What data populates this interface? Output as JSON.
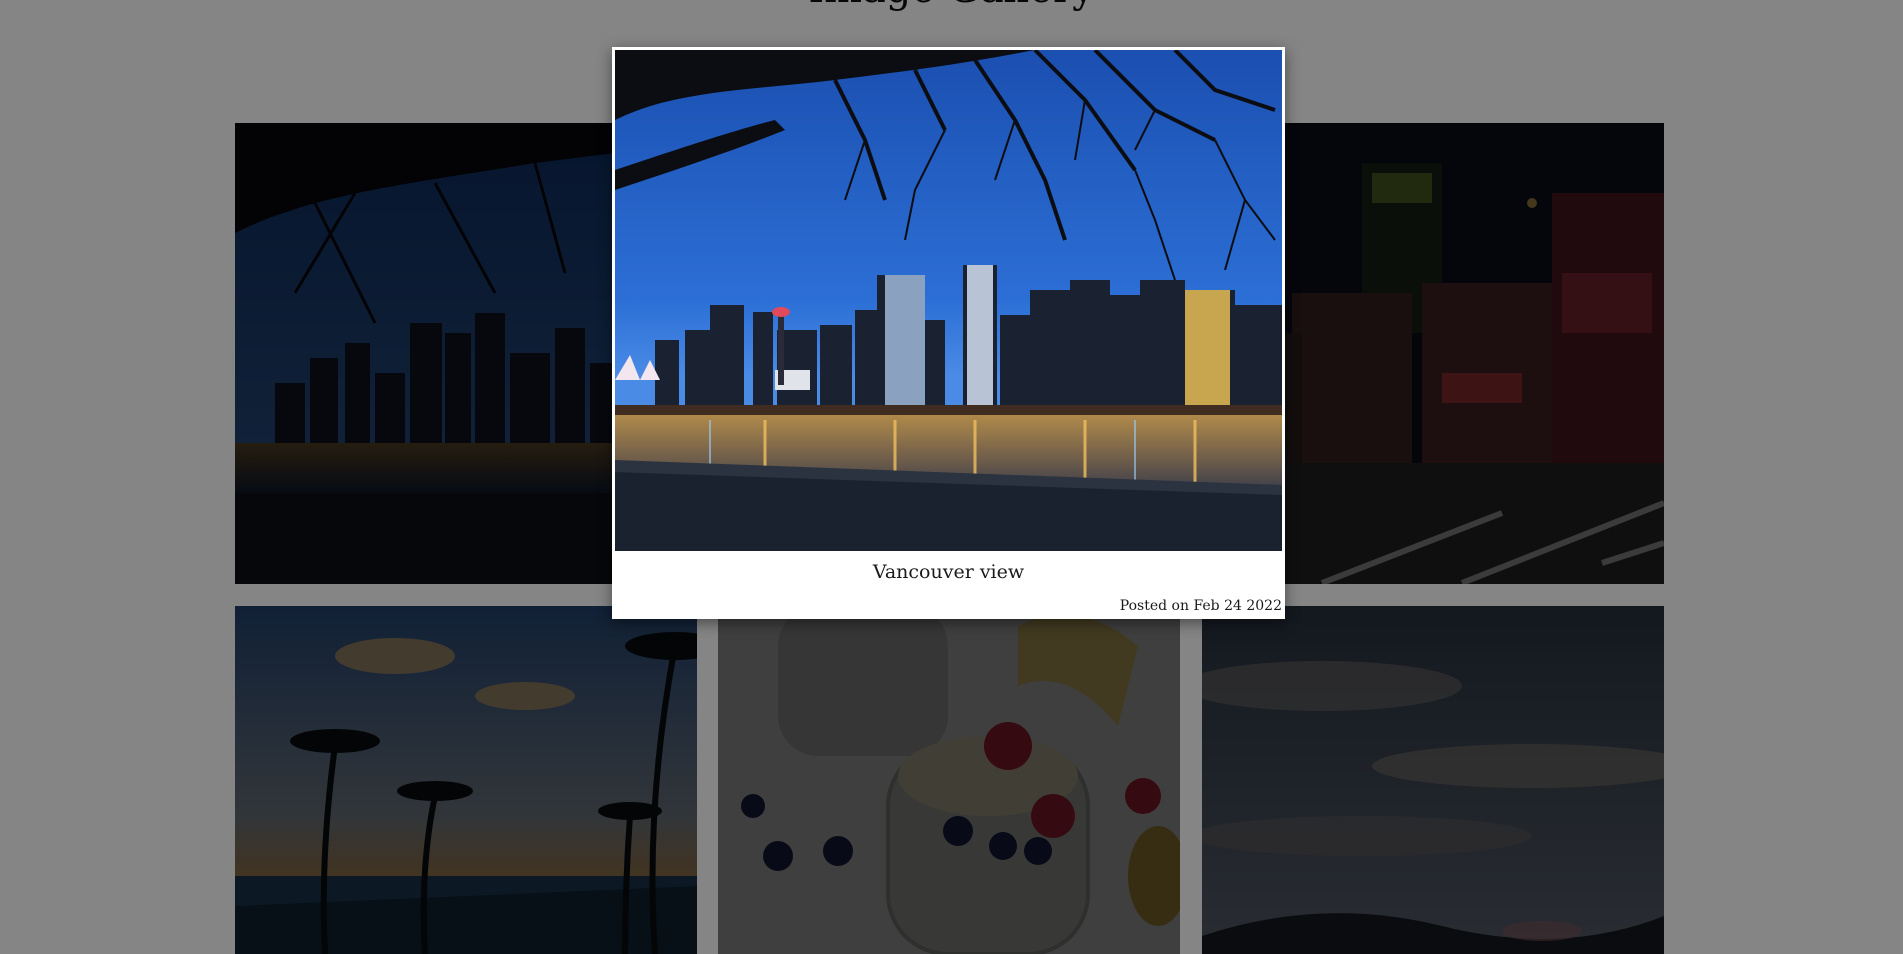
{
  "page": {
    "title": "Image Gallery"
  },
  "gallery": {
    "items": [
      {
        "label": "Vancouver skyline at night under tree branches",
        "icon": "city-photo"
      },
      {
        "label": "Downtown street with neon signs at night",
        "icon": "street-photo"
      },
      {
        "label": "Palm trees on beach at sunset",
        "icon": "beach-photo"
      },
      {
        "label": "Chia pudding with fruits",
        "icon": "food-photo"
      },
      {
        "label": "Cloudy evening sky",
        "icon": "sky-photo"
      }
    ]
  },
  "lightbox": {
    "caption": "Vancouver view",
    "posted": "Posted on Feb 24 2022"
  },
  "colors": {
    "overlay": "#000000",
    "modal_bg": "#ffffff",
    "night_sky": "#1f5fb8"
  }
}
